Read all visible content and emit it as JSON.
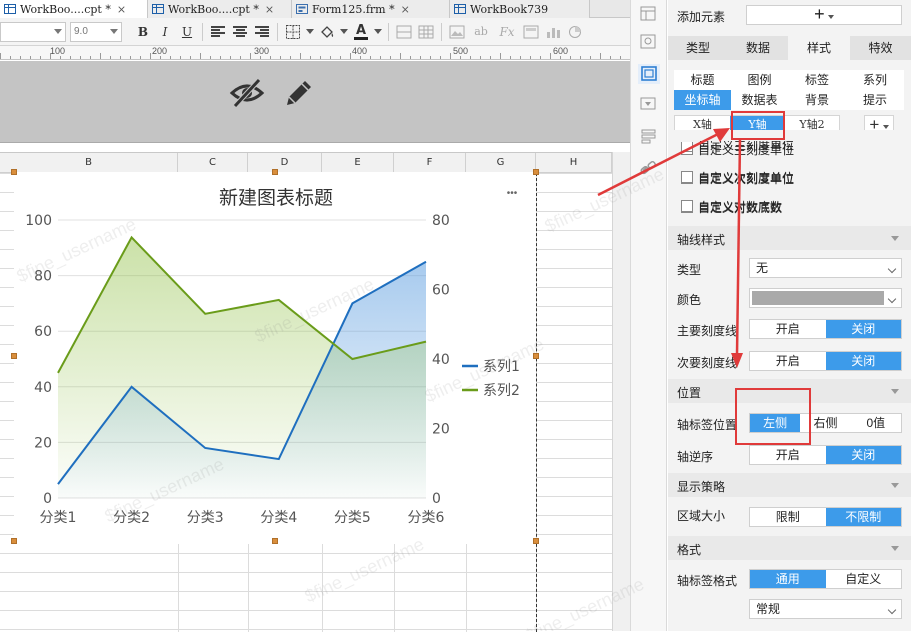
{
  "tabs": [
    {
      "label": "WorkBoo....cpt *",
      "active": true
    },
    {
      "label": "WorkBoo....cpt *",
      "active": false
    },
    {
      "label": "Form125.frm *",
      "active": false
    },
    {
      "label": "WorkBook739",
      "active": false
    }
  ],
  "toolbar": {
    "font_size": "9.0",
    "bold": "B",
    "italic": "I",
    "underline": "U",
    "font_color_letter": "A"
  },
  "ruler": {
    "marks": [
      "100",
      "200",
      "300",
      "400",
      "500",
      "600"
    ]
  },
  "columns": [
    "B",
    "C",
    "D",
    "E",
    "F",
    "G",
    "H"
  ],
  "chart_data": {
    "type": "area",
    "title": "新建图表标题",
    "categories": [
      "分类1",
      "分类2",
      "分类3",
      "分类4",
      "分类5",
      "分类6"
    ],
    "series": [
      {
        "name": "系列1",
        "axis": "left",
        "color": "#1f6fbf",
        "values": [
          5,
          40,
          18,
          14,
          70,
          85
        ]
      },
      {
        "name": "系列2",
        "axis": "right",
        "color": "#6a9c1a",
        "values": [
          36,
          75,
          53,
          57,
          40,
          45
        ]
      }
    ],
    "y_left": {
      "ticks": [
        "0",
        "20",
        "40",
        "60",
        "80",
        "100"
      ],
      "range": [
        0,
        100
      ]
    },
    "y_right": {
      "ticks": [
        "0",
        "20",
        "40",
        "60",
        "80"
      ],
      "range": [
        0,
        80
      ]
    },
    "legend": "right",
    "grid": true
  },
  "chart": {
    "more": "•••"
  },
  "panel": {
    "add_element_label": "添加元素",
    "add_symbol": "+",
    "main_tabs": [
      "类型",
      "数据",
      "样式",
      "特效"
    ],
    "main_tab_active": "样式",
    "sub_tabs_row1": [
      "标题",
      "图例",
      "标签",
      "系列"
    ],
    "sub_tabs_row2": [
      "坐标轴",
      "数据表",
      "背景",
      "提示"
    ],
    "sub_tab_active": "坐标轴",
    "axis_tabs": [
      "X轴",
      "Y轴",
      "Y轴2"
    ],
    "axis_tab_active": "Y轴",
    "checkboxes": [
      "自定义主刻度单位",
      "自定义次刻度单位",
      "自定义对数底数"
    ],
    "section_axis_style": "轴线样式",
    "type_label": "类型",
    "type_value": "无",
    "color_label": "颜色",
    "major_tick_label": "主要刻度线",
    "minor_tick_label": "次要刻度线",
    "on_label": "开启",
    "off_label": "关闭",
    "section_position": "位置",
    "label_position_label": "轴标签位置",
    "label_position_options": [
      "左侧",
      "右侧",
      "0值"
    ],
    "reverse_label": "轴逆序",
    "section_display": "显示策略",
    "area_size_label": "区域大小",
    "area_options": [
      "限制",
      "不限制"
    ],
    "section_format": "格式",
    "label_format_label": "轴标签格式",
    "format_options": [
      "通用",
      "自定义"
    ],
    "format_select_value": "常规"
  },
  "watermark": "$fine_username",
  "colors": {
    "accent": "#3d9bea",
    "annotation": "#e03a3a"
  }
}
